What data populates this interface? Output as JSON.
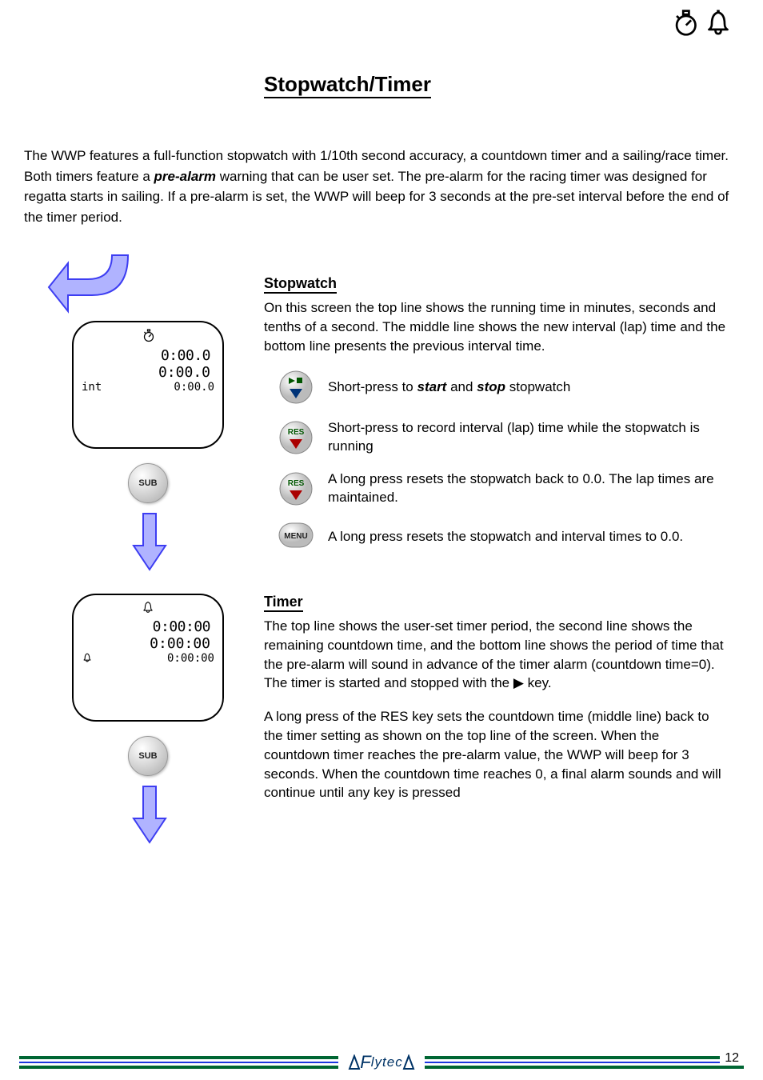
{
  "page_title": "Stopwatch/Timer",
  "intro": {
    "line1": "The WWP features a full-function stopwatch with 1/10th second accuracy, a countdown timer and a sailing/race timer. Both timers feature a ",
    "pre_alarm": "pre-alarm",
    "line2": " warning that can be user set. The pre-alarm for the racing timer was designed for regatta starts in sailing. If a pre-alarm is set, the WWP will beep for 3 seconds at the pre-set interval before the end of the timer period."
  },
  "stopwatch": {
    "heading": "Stopwatch",
    "desc": "On this screen the top line shows the running time in minutes, seconds and tenths of a second. The middle line shows the new interval (lap) time and the bottom line presents the previous interval time.",
    "rows": [
      {
        "pre": "Short-press to ",
        "b1": "start",
        "mid": " and ",
        "b2": "stop",
        "post": " stopwatch"
      },
      {
        "text": "Short-press to record interval (lap) time while the stopwatch is running"
      },
      {
        "text": "A long press resets the stopwatch back to 0.0. The lap times are maintained."
      },
      {
        "text": "A long press resets the stopwatch and interval times to 0.0."
      }
    ],
    "screen": {
      "big": "0:00.0",
      "mid": "0:00.0",
      "small_left": "int",
      "small_right": "0:00.0"
    }
  },
  "timer": {
    "heading": "Timer",
    "desc": "The top line shows the user-set timer period, the second line shows the remaining countdown time, and the bottom line shows the period of time that the pre-alarm will sound in advance of the timer alarm (countdown time=0). The timer is started and stopped with the ▶ key.",
    "desc2": "A long press of the RES key sets the countdown time (middle line) back to the timer setting as shown on the top line of the screen. When the countdown timer reaches the pre-alarm value, the WWP will beep for 3 seconds. When the countdown time reaches 0, a final alarm sounds and will continue until any key is pressed",
    "screen": {
      "big": "0:00:00",
      "mid": "0:00:00",
      "small_right": "0:00:00"
    }
  },
  "buttons": {
    "sub": "SUB",
    "res": "RES",
    "menu": "MENU"
  },
  "footer": {
    "brand": "Flytec",
    "page": "12"
  }
}
